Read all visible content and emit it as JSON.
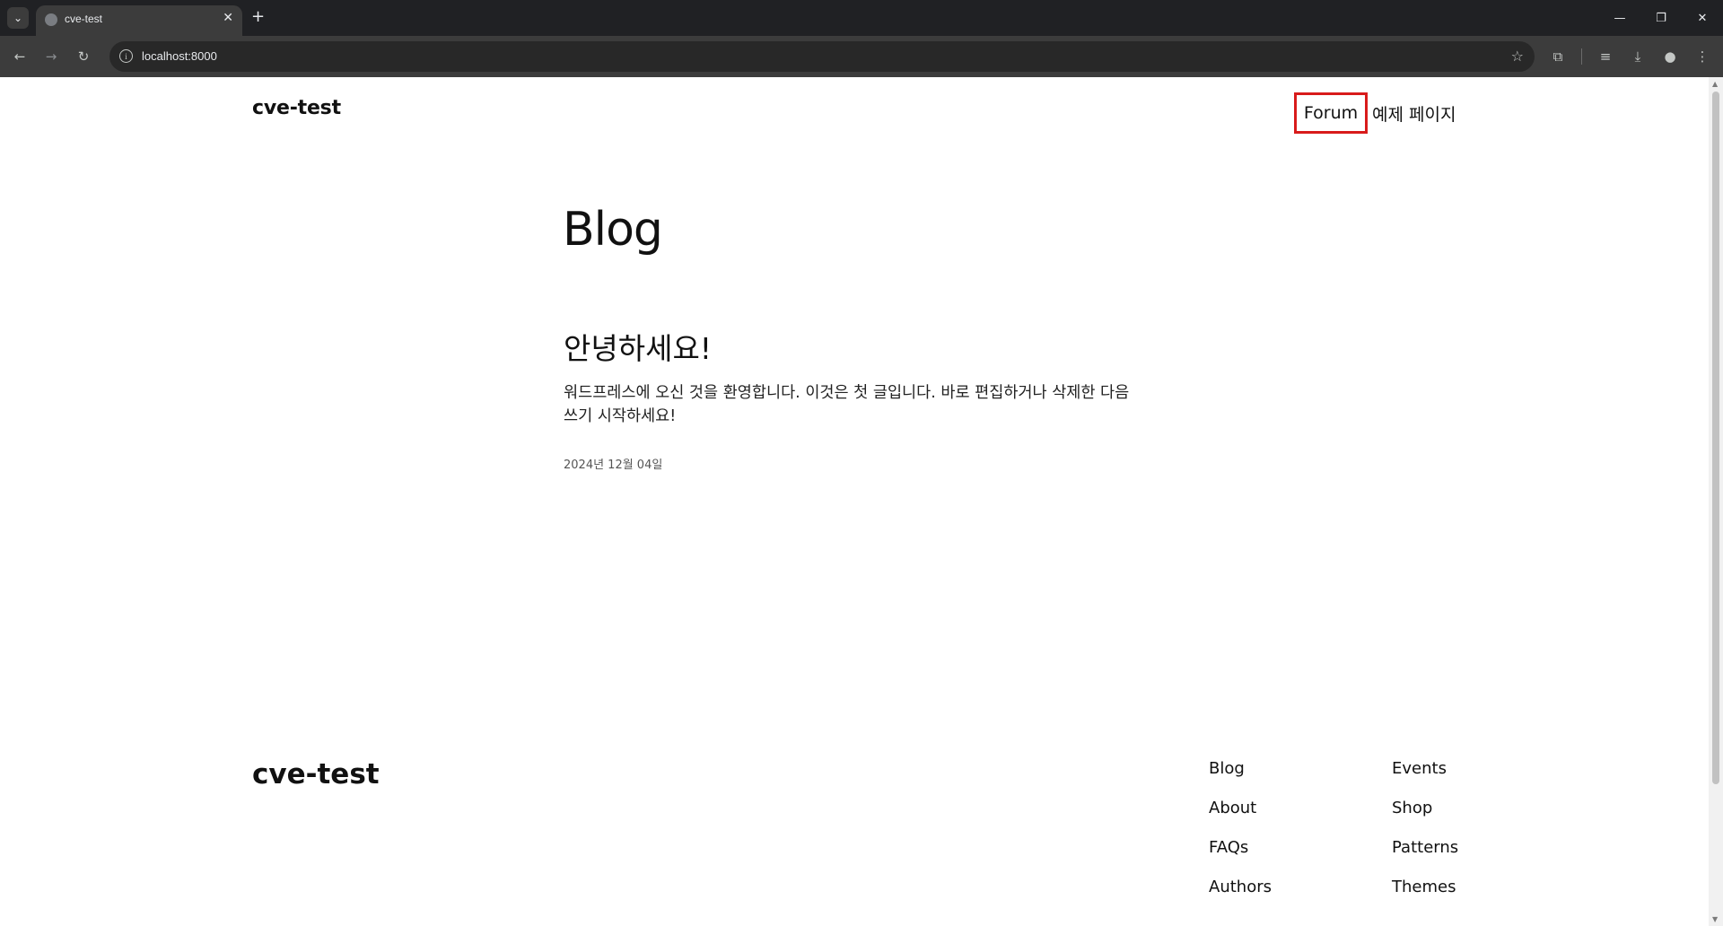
{
  "browser": {
    "tab_title": "cve-test",
    "tab_close": "✕",
    "new_tab": "+",
    "url": "localhost:8000"
  },
  "site": {
    "title": "cve-test",
    "nav": [
      {
        "label": "Forum",
        "highlighted": true
      },
      {
        "label": "예제 페이지"
      }
    ]
  },
  "main": {
    "heading": "Blog",
    "posts": [
      {
        "title": "안녕하세요!",
        "excerpt": "워드프레스에 오신 것을 환영합니다. 이것은 첫 글입니다. 바로 편집하거나 삭제한 다음 쓰기 시작하세요!",
        "date": "2024년 12월 04일"
      }
    ]
  },
  "footer": {
    "title": "cve-test",
    "columns": [
      [
        "Blog",
        "About",
        "FAQs",
        "Authors"
      ],
      [
        "Events",
        "Shop",
        "Patterns",
        "Themes"
      ]
    ]
  },
  "colors": {
    "highlight_border": "#d81b1b",
    "chrome_dark": "#202124",
    "chrome_toolbar": "#3c3c3c"
  },
  "icons": [
    "tab-search-icon",
    "globe-icon",
    "close-icon",
    "plus-icon",
    "back-icon",
    "forward-icon",
    "reload-icon",
    "info-icon",
    "star-icon",
    "extensions-icon",
    "media-icon",
    "download-icon",
    "profile-icon",
    "menu-icon",
    "minimize-icon",
    "restore-icon",
    "window-close-icon"
  ]
}
